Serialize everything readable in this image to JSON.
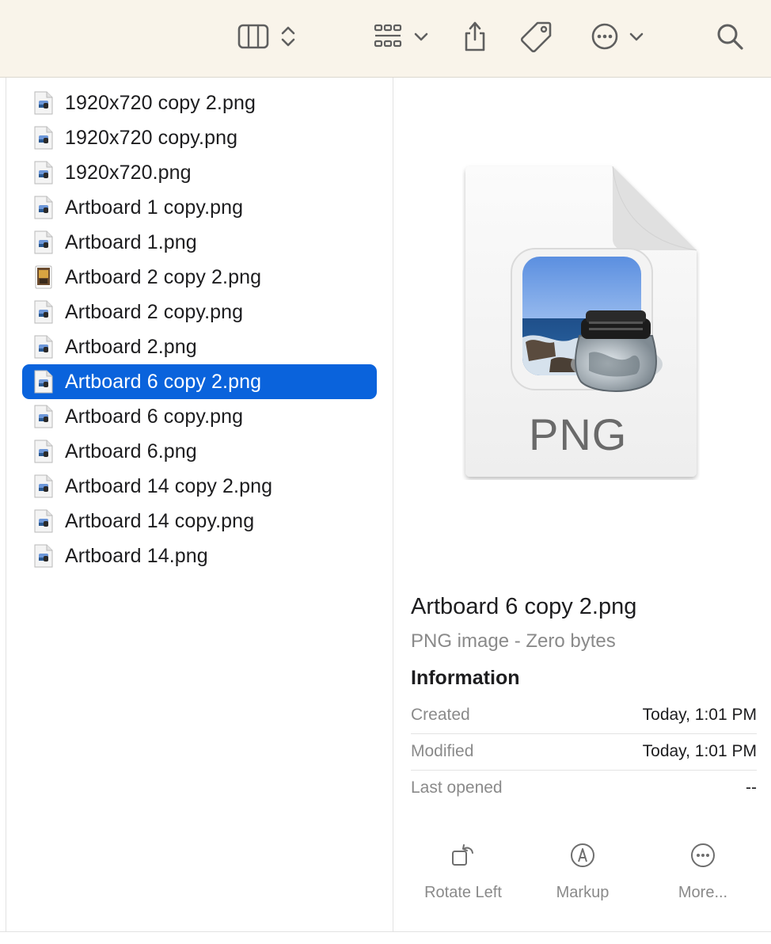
{
  "toolbar": {
    "icons": [
      "columns-view-icon",
      "sort-updown-icon",
      "group-grid-icon",
      "chevron-down-icon",
      "share-icon",
      "tag-icon",
      "more-ellipsis-icon",
      "chevron-down-icon",
      "search-icon"
    ]
  },
  "files": [
    {
      "name": "1920x720 copy 2.png",
      "icon": "png-file-icon",
      "selected": false
    },
    {
      "name": "1920x720 copy.png",
      "icon": "png-file-icon",
      "selected": false
    },
    {
      "name": "1920x720.png",
      "icon": "png-file-icon",
      "selected": false
    },
    {
      "name": "Artboard 1 copy.png",
      "icon": "png-file-icon",
      "selected": false
    },
    {
      "name": "Artboard 1.png",
      "icon": "png-file-icon",
      "selected": false
    },
    {
      "name": "Artboard 2 copy 2.png",
      "icon": "image-thumbnail-icon",
      "selected": false
    },
    {
      "name": "Artboard 2 copy.png",
      "icon": "png-file-icon",
      "selected": false
    },
    {
      "name": "Artboard 2.png",
      "icon": "png-file-icon",
      "selected": false
    },
    {
      "name": "Artboard 6 copy 2.png",
      "icon": "png-file-icon",
      "selected": true
    },
    {
      "name": "Artboard 6 copy.png",
      "icon": "png-file-icon",
      "selected": false
    },
    {
      "name": "Artboard 6.png",
      "icon": "png-file-icon",
      "selected": false
    },
    {
      "name": "Artboard 14 copy 2.png",
      "icon": "png-file-icon",
      "selected": false
    },
    {
      "name": "Artboard 14 copy.png",
      "icon": "png-file-icon",
      "selected": false
    },
    {
      "name": "Artboard 14.png",
      "icon": "png-file-icon",
      "selected": false
    }
  ],
  "preview": {
    "icon_label": "PNG",
    "title": "Artboard 6 copy 2.png",
    "subtitle": "PNG image - Zero bytes",
    "info_heading": "Information",
    "info": [
      {
        "key": "Created",
        "value": "Today, 1:01 PM"
      },
      {
        "key": "Modified",
        "value": "Today, 1:01 PM"
      },
      {
        "key": "Last opened",
        "value": "--"
      }
    ],
    "actions": [
      {
        "label": "Rotate Left",
        "icon": "rotate-left-icon"
      },
      {
        "label": "Markup",
        "icon": "markup-pen-icon"
      },
      {
        "label": "More...",
        "icon": "more-ellipsis-icon"
      }
    ]
  },
  "colors": {
    "toolbar_bg": "#f9f4ea",
    "selection": "#0a63dc",
    "secondary_text": "#8a8a8a"
  }
}
